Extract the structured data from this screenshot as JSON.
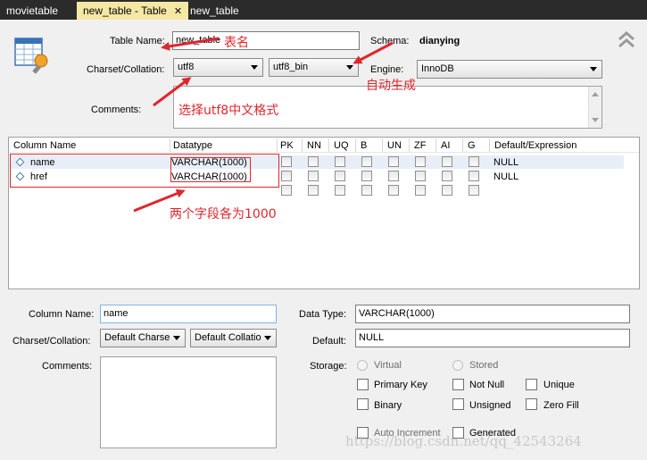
{
  "tabs": [
    {
      "label": "movietable"
    },
    {
      "label": "new_table - Table",
      "close": "✕"
    },
    {
      "label": "new_table"
    }
  ],
  "table_form": {
    "table_name_label": "Table Name:",
    "table_name_value": "new_table",
    "schema_label": "Schema:",
    "schema_value": "dianying",
    "charset_label": "Charset/Collation:",
    "charset_value": "utf8",
    "collation_value": "utf8_bin",
    "engine_label": "Engine:",
    "engine_value": "InnoDB",
    "comments_label": "Comments:"
  },
  "grid": {
    "headers": [
      "Column Name",
      "Datatype",
      "PK",
      "NN",
      "UQ",
      "B",
      "UN",
      "ZF",
      "AI",
      "G",
      "Default/Expression"
    ],
    "rows": [
      {
        "name": "name",
        "datatype": "VARCHAR(1000)",
        "default": "NULL"
      },
      {
        "name": "href",
        "datatype": "VARCHAR(1000)",
        "default": "NULL"
      }
    ]
  },
  "column_detail": {
    "column_name_label": "Column Name:",
    "column_name_value": "name",
    "charset_label": "Charset/Collation:",
    "charset_value": "Default Charse",
    "collation_value": "Default Collatio",
    "comments_label": "Comments:",
    "datatype_label": "Data Type:",
    "datatype_value": "VARCHAR(1000)",
    "default_label": "Default:",
    "default_value": "NULL",
    "storage_label": "Storage:",
    "virtual_label": "Virtual",
    "stored_label": "Stored",
    "primary_key_label": "Primary Key",
    "not_null_label": "Not Null",
    "unique_label": "Unique",
    "binary_label": "Binary",
    "unsigned_label": "Unsigned",
    "zero_fill_label": "Zero Fill",
    "auto_increment_label": "Auto Increment",
    "generated_label": "Generated"
  },
  "annotations": {
    "table_name_note": "表名",
    "auto_generated_note": "自动生成",
    "utf8_note": "选择utf8中文格式",
    "fields_note": "两个字段各为1000"
  },
  "watermark": "https://blog.csdn.net/qq_42543264",
  "colors": {
    "annotation_red": "#e0262d",
    "active_tab": "#f5e7a4",
    "tabbar": "#2b2b2b"
  }
}
